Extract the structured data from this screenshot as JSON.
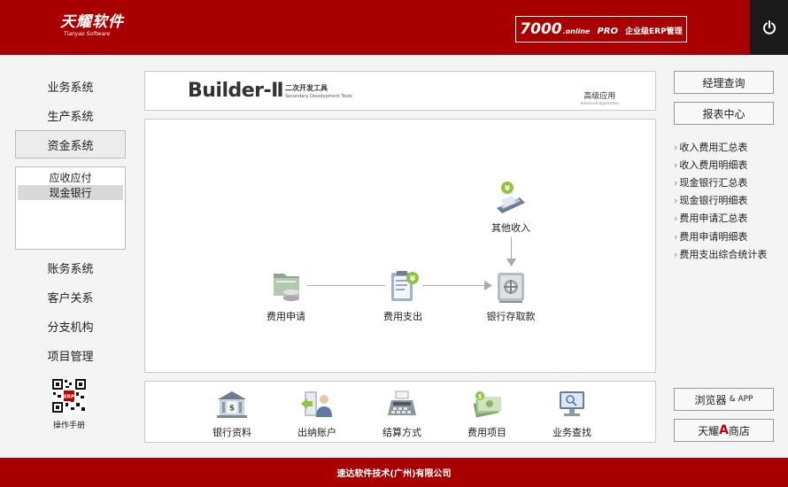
{
  "header": {
    "logo_main": "天耀软件",
    "logo_sub": "Tianyao Software",
    "erp_num": "7000",
    "erp_online": ".online",
    "erp_pro": "PRO",
    "erp_text": "企业级ERP管理",
    "power_icon": "power-icon"
  },
  "sidebar": {
    "items_top": [
      {
        "label": "业务系统"
      },
      {
        "label": "生产系统"
      },
      {
        "label": "资金系统",
        "active": true
      }
    ],
    "subitems": [
      {
        "label": "应收应付"
      },
      {
        "label": "现金银行",
        "active": true
      }
    ],
    "items_bottom": [
      {
        "label": "账务系统"
      },
      {
        "label": "客户关系"
      },
      {
        "label": "分支机构"
      },
      {
        "label": "项目管理"
      }
    ],
    "qr_label": "操作手册",
    "qr_badge": "ERP"
  },
  "banner": {
    "builder": "Builder-Ⅱ",
    "builder_cn": "二次开发工具",
    "builder_en": "Secondary Development Tools",
    "adv_cn": "高级应用",
    "adv_en": "Advanced Application"
  },
  "flow": {
    "nodes": [
      {
        "label": "费用申请",
        "icon": "expense-request-icon"
      },
      {
        "label": "费用支出",
        "icon": "expense-payment-icon"
      },
      {
        "label": "银行存取款",
        "icon": "bank-deposit-icon"
      },
      {
        "label": "其他收入",
        "icon": "other-income-icon"
      }
    ]
  },
  "tools": [
    {
      "label": "银行资料",
      "icon": "bank-info-icon"
    },
    {
      "label": "出纳账户",
      "icon": "cashier-account-icon"
    },
    {
      "label": "结算方式",
      "icon": "settlement-icon"
    },
    {
      "label": "费用项目",
      "icon": "expense-item-icon"
    },
    {
      "label": "业务查找",
      "icon": "business-search-icon"
    }
  ],
  "right": {
    "btn_manager": "经理查询",
    "btn_report": "报表中心",
    "links": [
      {
        "label": "收入费用汇总表"
      },
      {
        "label": "收入费用明细表"
      },
      {
        "label": "现金银行汇总表"
      },
      {
        "label": "现金银行明细表"
      },
      {
        "label": "费用申请汇总表"
      },
      {
        "label": "费用申请明细表"
      },
      {
        "label": "费用支出综合统计表"
      }
    ],
    "btn_browser": "浏览器",
    "btn_browser_app": "& APP",
    "btn_shop_pre": "天耀",
    "btn_shop_a": "A",
    "btn_shop_post": "商店",
    "link_arrow": "›"
  },
  "footer": {
    "text": "速达软件技术(广州)有限公司"
  }
}
